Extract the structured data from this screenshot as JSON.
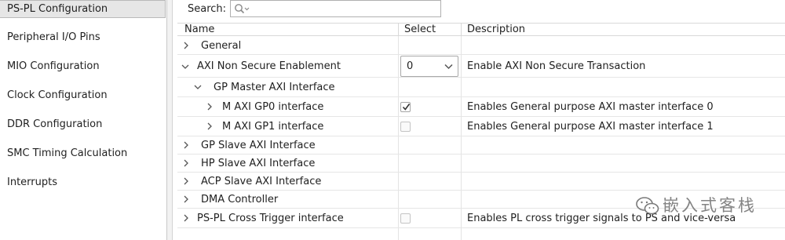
{
  "nav": {
    "items": [
      {
        "label": "PS-PL Configuration",
        "selected": true
      },
      {
        "label": "Peripheral I/O Pins",
        "selected": false
      },
      {
        "label": "MIO Configuration",
        "selected": false
      },
      {
        "label": "Clock Configuration",
        "selected": false
      },
      {
        "label": "DDR Configuration",
        "selected": false
      },
      {
        "label": "SMC Timing Calculation",
        "selected": false
      },
      {
        "label": "Interrupts",
        "selected": false
      }
    ]
  },
  "search": {
    "label": "Search:",
    "value": "",
    "icon": "search-icon"
  },
  "table": {
    "columns": {
      "name": "Name",
      "select": "Select",
      "description": "Description"
    },
    "rows": [
      {
        "name": "General",
        "expanded": false,
        "level": 0,
        "select": null,
        "description": ""
      },
      {
        "name": "AXI Non Secure Enablement",
        "expanded": true,
        "level": 0,
        "select": {
          "type": "dropdown",
          "value": "0"
        },
        "description": "Enable AXI Non Secure Transaction"
      },
      {
        "name": "GP Master AXI Interface",
        "expanded": true,
        "level": 1,
        "select": null,
        "description": ""
      },
      {
        "name": "M AXI GP0 interface",
        "expanded": false,
        "level": 2,
        "select": {
          "type": "checkbox",
          "checked": true
        },
        "description": "Enables General purpose AXI master interface 0"
      },
      {
        "name": "M AXI GP1 interface",
        "expanded": false,
        "level": 2,
        "select": {
          "type": "checkbox",
          "checked": false
        },
        "description": "Enables General purpose AXI master interface 1"
      },
      {
        "name": "GP Slave AXI Interface",
        "expanded": false,
        "level": 0,
        "select": null,
        "description": ""
      },
      {
        "name": "HP Slave AXI Interface",
        "expanded": false,
        "level": 0,
        "select": null,
        "description": ""
      },
      {
        "name": "ACP Slave AXI Interface",
        "expanded": false,
        "level": 0,
        "select": null,
        "description": ""
      },
      {
        "name": "DMA Controller",
        "expanded": false,
        "level": 0,
        "select": null,
        "description": ""
      },
      {
        "name": "PS-PL Cross Trigger interface",
        "expanded": false,
        "level": 0,
        "select": {
          "type": "checkbox",
          "checked": false
        },
        "description": "Enables PL cross trigger signals to PS and vice-versa"
      }
    ]
  },
  "watermark": {
    "text": "嵌入式客栈",
    "icon": "wechat-icon"
  },
  "colors": {
    "selected_nav_bg": "#e6e6e6",
    "text": "#1f1f1f",
    "grid_line": "#e6e6e6"
  }
}
